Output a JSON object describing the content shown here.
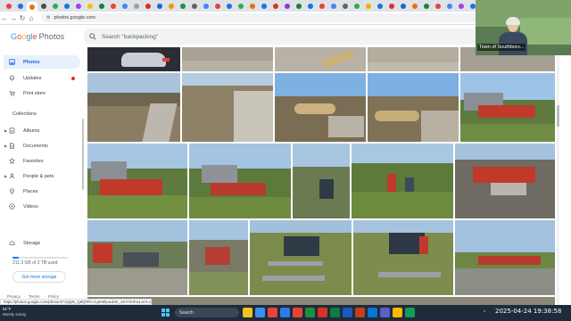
{
  "browser": {
    "tab_count": 46,
    "active_tab_index": 2,
    "tab_colors": [
      "#ea4335",
      "#1a73e8",
      "#e8710a",
      "#4a4a4a",
      "#34a853",
      "#1a73e8",
      "#a142f4",
      "#fbbc05",
      "#188038",
      "#ea4335",
      "#4285f4",
      "#9aa0a6",
      "#d93025",
      "#1967d2",
      "#f29900",
      "#1e8e3e",
      "#5f6368",
      "#4285f4",
      "#ea4335",
      "#1a73e8",
      "#34a853",
      "#e37400",
      "#1a73e8",
      "#d93025",
      "#9334e6",
      "#188038",
      "#1a73e8",
      "#ea4335",
      "#4285f4",
      "#5f6368",
      "#34a853",
      "#f9ab00",
      "#1a73e8",
      "#d93025",
      "#1967d2",
      "#e8710a",
      "#188038",
      "#ea4335",
      "#4285f4",
      "#a142f4",
      "#1a73e8",
      "#34a853",
      "#5f6368",
      "#ea4335",
      "#1a73e8",
      "#fbbc05"
    ],
    "url": "photos.google.com",
    "nav_back": "←",
    "nav_forward": "→",
    "nav_reload": "↻",
    "nav_home": "⌂"
  },
  "app": {
    "logo_google": [
      "G",
      "o",
      "o",
      "g",
      "l",
      "e"
    ],
    "logo_photos": "Photos",
    "search_placeholder": "Search \"backpacking\""
  },
  "sidebar": {
    "items": [
      {
        "label": "Photos",
        "icon": "photos-icon",
        "active": true
      },
      {
        "label": "Updates",
        "icon": "bell-icon",
        "badge": true
      },
      {
        "label": "Print store",
        "icon": "cart-icon"
      }
    ],
    "collections_label": "Collections",
    "collections": [
      {
        "label": "Albums",
        "icon": "album-icon",
        "expandable": true
      },
      {
        "label": "Documents",
        "icon": "document-icon",
        "expandable": true
      },
      {
        "label": "Favorites",
        "icon": "star-icon"
      },
      {
        "label": "People & pets",
        "icon": "people-icon",
        "expandable": true
      },
      {
        "label": "Places",
        "icon": "place-icon"
      },
      {
        "label": "Videos",
        "icon": "video-icon"
      }
    ],
    "storage": {
      "label": "Storage",
      "used_text": "211.3 GB of 2 TB used",
      "used_fraction": 0.106,
      "button": "Get more storage"
    },
    "footer": [
      "Privacy",
      "·",
      "Terms",
      "·",
      "Policy"
    ]
  },
  "video_overlay": {
    "caption": "Town of Southboro..."
  },
  "status_bar": {
    "url_text": "https://photos.google.com/photo/AF1QipN_Q8QhRl-cCpI05fywuD0r_4DYhKIPu4Jx7Ls"
  },
  "taskbar": {
    "weather_temp": "61°F",
    "weather_desc": "Mostly sunny",
    "search_label": "Search",
    "app_colors": [
      "#f0c419",
      "#3c8df0",
      "#e94335",
      "#2b7ce9",
      "#ea4335",
      "#1e8e3e",
      "#d93025",
      "#107c41",
      "#185abd",
      "#c43e1c",
      "#0078d4",
      "#5b5fc7",
      "#ffb900",
      "#0f9d58"
    ],
    "clock": "2025-04-24  19:38:58"
  }
}
